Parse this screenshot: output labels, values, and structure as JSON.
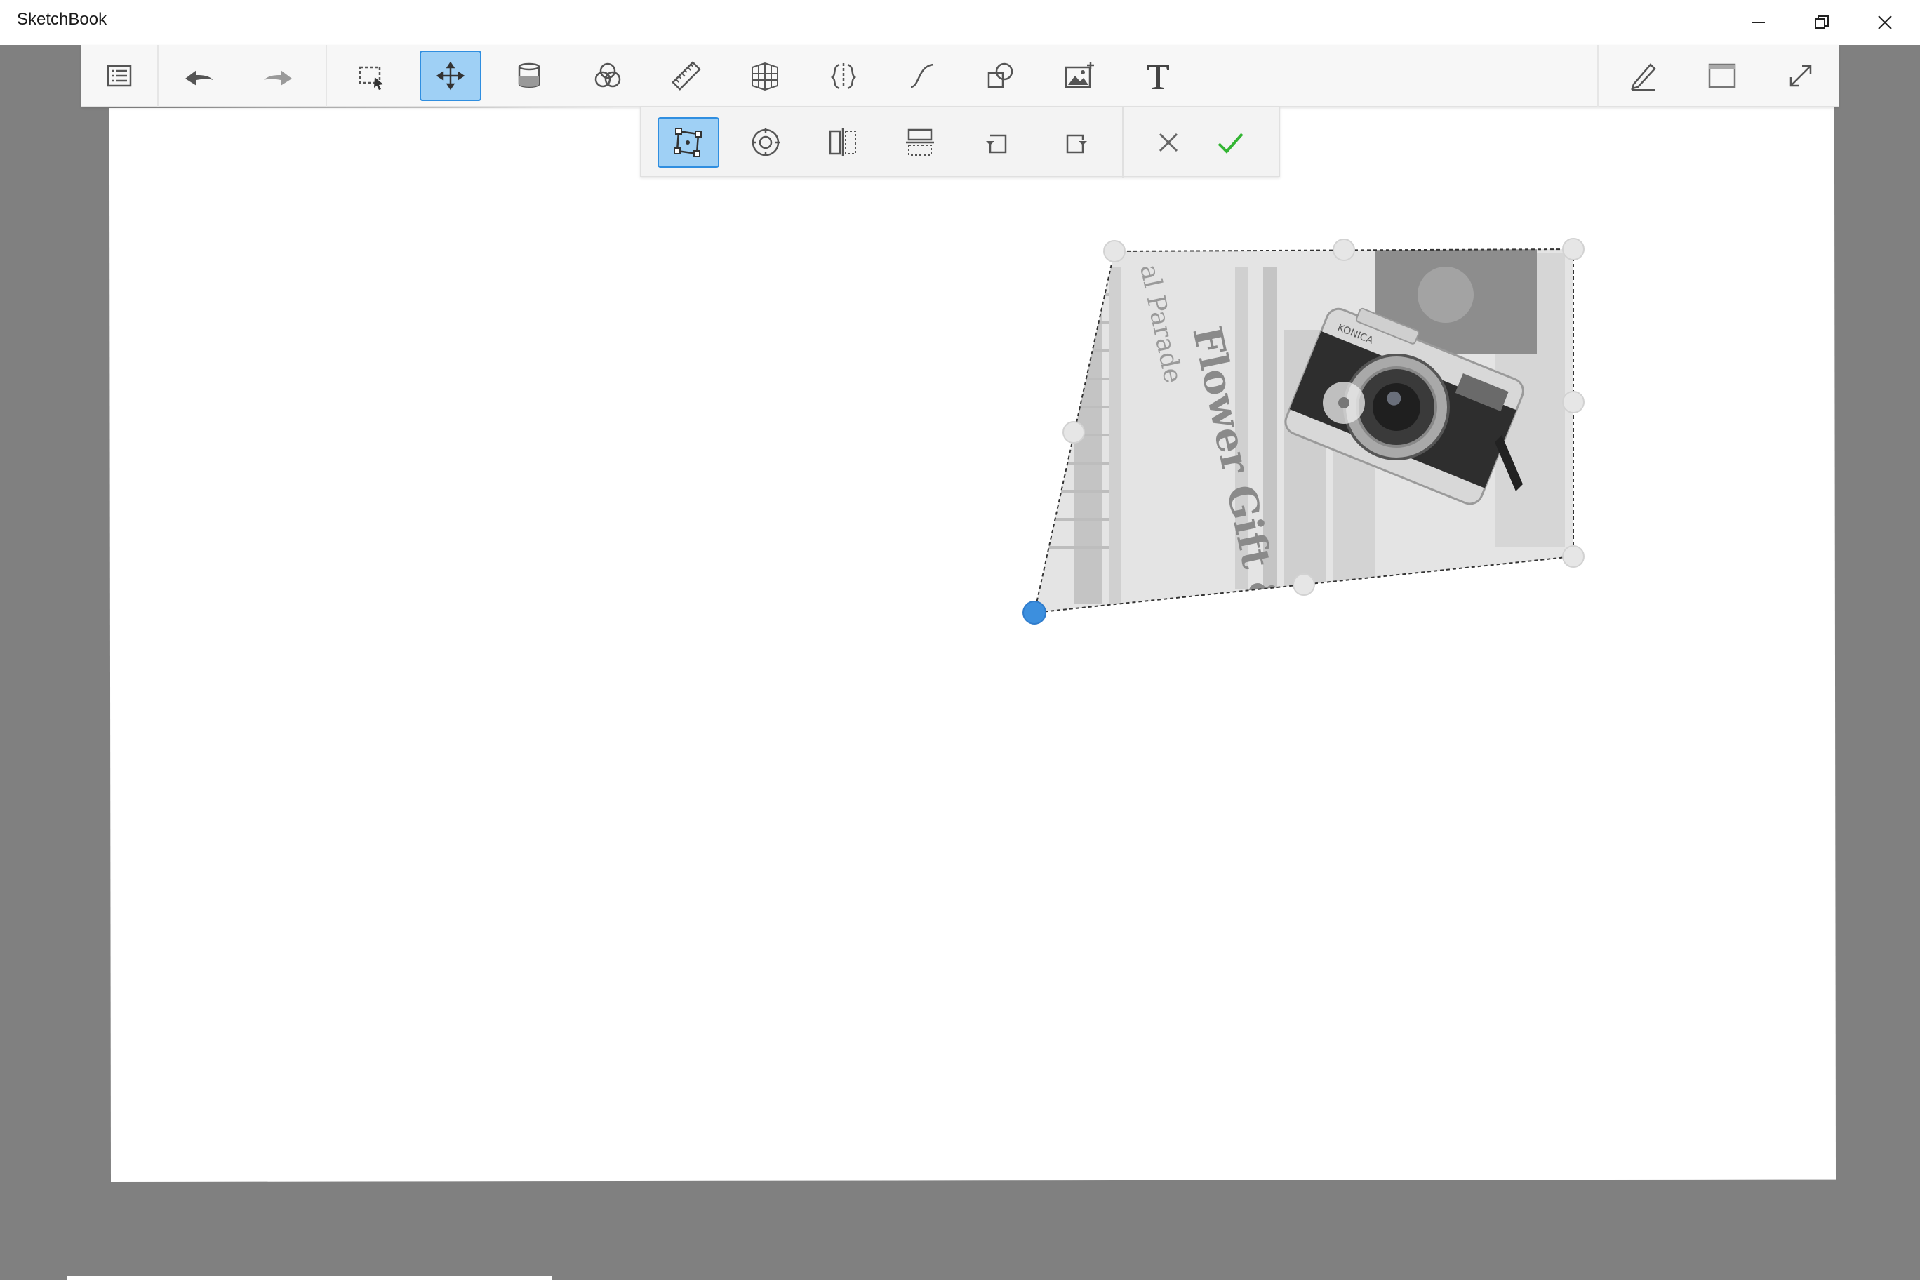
{
  "app": {
    "title": "SketchBook"
  },
  "window_controls": {
    "minimize_icon": "minimize-icon",
    "restore_icon": "restore-icon",
    "close_icon": "close-icon"
  },
  "main_toolbar": {
    "tools": [
      {
        "id": "menu",
        "icon": "list-menu-icon",
        "active": false
      },
      {
        "id": "undo",
        "icon": "undo-arrow-icon",
        "active": false
      },
      {
        "id": "redo",
        "icon": "redo-arrow-icon",
        "active": false
      },
      {
        "id": "selection",
        "icon": "selection-icon",
        "active": false
      },
      {
        "id": "transform",
        "icon": "move-icon",
        "active": true
      },
      {
        "id": "fill",
        "icon": "paint-bucket-icon",
        "active": false
      },
      {
        "id": "color",
        "icon": "color-circles-icon",
        "active": false
      },
      {
        "id": "ruler",
        "icon": "ruler-icon",
        "active": false
      },
      {
        "id": "perspective",
        "icon": "perspective-grid-icon",
        "active": false
      },
      {
        "id": "symmetry",
        "icon": "symmetry-icon",
        "active": false
      },
      {
        "id": "curve",
        "icon": "curve-icon",
        "active": false
      },
      {
        "id": "shapes",
        "icon": "shapes-icon",
        "active": false
      },
      {
        "id": "add-image",
        "icon": "add-image-icon",
        "active": false
      },
      {
        "id": "text",
        "icon": "text-icon",
        "active": false
      },
      {
        "id": "brush",
        "icon": "pen-icon",
        "active": false
      },
      {
        "id": "layout",
        "icon": "window-icon",
        "active": false
      },
      {
        "id": "fullscreen",
        "icon": "expand-icon",
        "active": false
      }
    ]
  },
  "transform_toolbar": {
    "tools": [
      {
        "id": "distort",
        "icon": "distort-icon",
        "active": true
      },
      {
        "id": "pivot",
        "icon": "pivot-icon",
        "active": false
      },
      {
        "id": "flip-horizontal",
        "icon": "flip-horizontal-icon",
        "active": false
      },
      {
        "id": "flip-vertical",
        "icon": "flip-vertical-icon",
        "active": false
      },
      {
        "id": "rotate-left",
        "icon": "rotate-left-icon",
        "active": false
      },
      {
        "id": "rotate-right",
        "icon": "rotate-right-icon",
        "active": false
      },
      {
        "id": "cancel",
        "icon": "cancel-icon",
        "active": false
      },
      {
        "id": "confirm",
        "icon": "checkmark-icon",
        "active": false
      }
    ]
  },
  "canvas": {
    "image_layer": {
      "newspaper_text": [
        "Flower Gift & Card S",
        "al Parade"
      ],
      "camera_brand": "KONICA",
      "active_handle_color": "#3c8fde",
      "handle_color": "#e6e6e6"
    }
  },
  "colors": {
    "accent": "#2f8ee0",
    "accent_fill": "#9fd0f5",
    "confirm_green": "#33b533",
    "workspace_gray": "#808080"
  }
}
